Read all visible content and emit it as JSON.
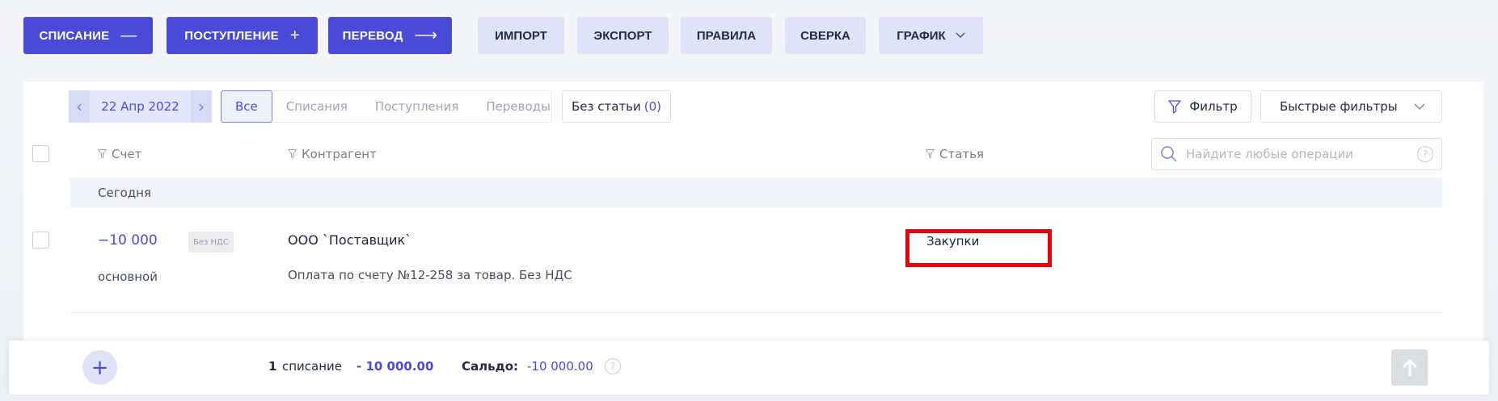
{
  "toolbar": {
    "writeoff": "СПИСАНИЕ",
    "writeoff_glyph": "—",
    "income": "ПОСТУПЛЕНИЕ",
    "income_glyph": "+",
    "transfer": "ПЕРЕВОД",
    "transfer_glyph": "⟶",
    "import": "ИМПОРТ",
    "export": "ЭКСПОРТ",
    "rules": "ПРАВИЛА",
    "reconcile": "СВЕРКА",
    "schedule": "ГРАФИК"
  },
  "date_nav": {
    "prev": "‹",
    "date": "22 Апр 2022",
    "next": "›"
  },
  "type_tabs": [
    {
      "label": "Все",
      "active": true
    },
    {
      "label": "Списания",
      "active": false
    },
    {
      "label": "Поступления",
      "active": false
    },
    {
      "label": "Переводы",
      "active": false
    }
  ],
  "no_article": {
    "label": "Без статьи",
    "count": "(0)"
  },
  "filter": {
    "label": "Фильтр"
  },
  "quick_filters": {
    "label": "Быстрые фильтры"
  },
  "columns": {
    "account": "Счет",
    "counterparty": "Контрагент",
    "article": "Статья"
  },
  "search": {
    "placeholder": "Найдите любые операции",
    "help": "?"
  },
  "group": {
    "label": "Сегодня"
  },
  "operation": {
    "amount": "−10 000",
    "vat": "Без НДС",
    "account": "основной",
    "counterparty": "ООО `Поставщик`",
    "description": "Оплата по счету №12-258 за товар. Без НДС",
    "article": "Закупки"
  },
  "summary": {
    "add": "+",
    "count": "1",
    "count_label": "списание",
    "total": "- 10 000.00",
    "balance_label": "Сальдо:",
    "balance": "-10 000.00",
    "help": "?"
  },
  "colors": {
    "accent": "#4a4ad8",
    "accent_light": "#dfe3f7",
    "highlight": "#e2060f"
  },
  "icons": [
    "minus-icon",
    "plus-icon",
    "arrow-right-icon",
    "chevron-down-icon",
    "chevron-left-icon",
    "chevron-right-icon",
    "funnel-icon",
    "search-icon",
    "help-icon",
    "arrow-up-icon"
  ]
}
